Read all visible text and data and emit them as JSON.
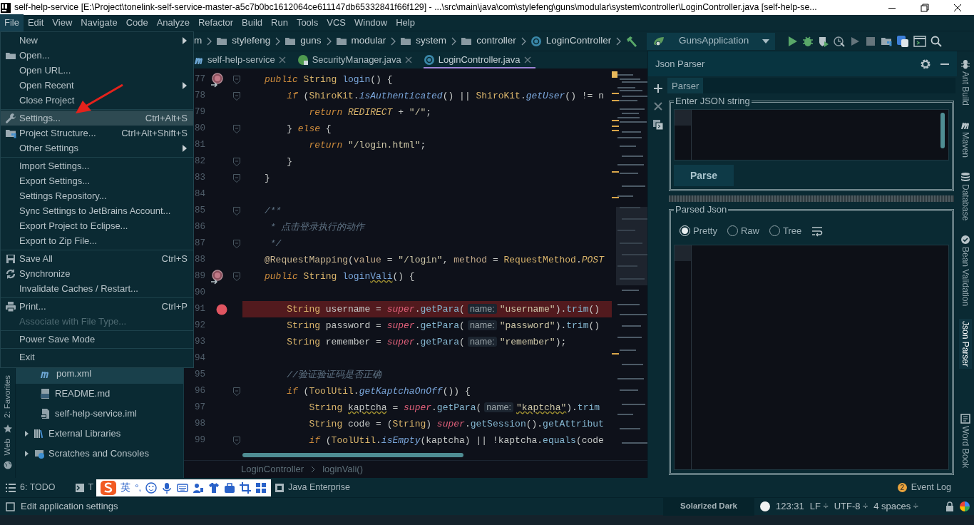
{
  "window": {
    "title": "self-help-service [E:\\Project\\tonelink-self-service-master-a5c7b0bc1612064ce611147db65332841f66f129] - ...\\src\\main\\java\\com\\stylefeng\\guns\\modular\\system\\controller\\LoginController.java [self-help-se..."
  },
  "menu_bar": [
    {
      "label": "File",
      "selected": true
    },
    {
      "label": "Edit",
      "selected": false
    },
    {
      "label": "View",
      "selected": false
    },
    {
      "label": "Navigate",
      "selected": false
    },
    {
      "label": "Code",
      "selected": false
    },
    {
      "label": "Analyze",
      "selected": false
    },
    {
      "label": "Refactor",
      "selected": false
    },
    {
      "label": "Build",
      "selected": false
    },
    {
      "label": "Run",
      "selected": false
    },
    {
      "label": "Tools",
      "selected": false
    },
    {
      "label": "VCS",
      "selected": false
    },
    {
      "label": "Window",
      "selected": false
    },
    {
      "label": "Help",
      "selected": false
    }
  ],
  "file_menu": [
    {
      "kind": "item",
      "label": "New",
      "submenu": true,
      "disabled": false,
      "selected": false
    },
    {
      "kind": "item",
      "label": "Open...",
      "submenu": false,
      "disabled": false,
      "selected": false
    },
    {
      "kind": "item",
      "label": "Open URL...",
      "submenu": false,
      "disabled": false,
      "selected": false
    },
    {
      "kind": "item",
      "label": "Open Recent",
      "submenu": true,
      "disabled": false,
      "selected": false
    },
    {
      "kind": "item",
      "label": "Close Project",
      "submenu": false,
      "disabled": false,
      "selected": false
    },
    {
      "kind": "separator"
    },
    {
      "kind": "item",
      "label": "Settings...",
      "shortcut": "Ctrl+Alt+S",
      "submenu": false,
      "disabled": false,
      "selected": true
    },
    {
      "kind": "item",
      "label": "Project Structure...",
      "shortcut": "Ctrl+Alt+Shift+S",
      "submenu": false,
      "disabled": false,
      "selected": false
    },
    {
      "kind": "item",
      "label": "Other Settings",
      "submenu": true,
      "disabled": false,
      "selected": false
    },
    {
      "kind": "separator"
    },
    {
      "kind": "item",
      "label": "Import Settings...",
      "submenu": false,
      "disabled": false,
      "selected": false
    },
    {
      "kind": "item",
      "label": "Export Settings...",
      "submenu": false,
      "disabled": false,
      "selected": false
    },
    {
      "kind": "item",
      "label": "Settings Repository...",
      "submenu": false,
      "disabled": false,
      "selected": false
    },
    {
      "kind": "item",
      "label": "Sync Settings to JetBrains Account...",
      "submenu": false,
      "disabled": false,
      "selected": false
    },
    {
      "kind": "item",
      "label": "Export Project to Eclipse...",
      "submenu": false,
      "disabled": false,
      "selected": false
    },
    {
      "kind": "item",
      "label": "Export to Zip File...",
      "submenu": false,
      "disabled": false,
      "selected": false
    },
    {
      "kind": "separator"
    },
    {
      "kind": "item",
      "label": "Save All",
      "shortcut": "Ctrl+S",
      "submenu": false,
      "disabled": false,
      "selected": false
    },
    {
      "kind": "item",
      "label": "Synchronize",
      "submenu": false,
      "disabled": false,
      "selected": false
    },
    {
      "kind": "item",
      "label": "Invalidate Caches / Restart...",
      "submenu": false,
      "disabled": false,
      "selected": false
    },
    {
      "kind": "separator"
    },
    {
      "kind": "item",
      "label": "Print...",
      "shortcut": "Ctrl+P",
      "submenu": false,
      "disabled": false,
      "selected": false
    },
    {
      "kind": "item",
      "label": "Associate with File Type...",
      "submenu": false,
      "disabled": true,
      "selected": false
    },
    {
      "kind": "separator"
    },
    {
      "kind": "item",
      "label": "Power Save Mode",
      "submenu": false,
      "disabled": false,
      "selected": false
    },
    {
      "kind": "separator"
    },
    {
      "kind": "item",
      "label": "Exit",
      "submenu": false,
      "disabled": false,
      "selected": false
    }
  ],
  "breadcrumbs": [
    "m",
    "stylefeng",
    "guns",
    "modular",
    "system",
    "controller",
    "LoginController"
  ],
  "run_config": "GunsApplication",
  "editor_tabs": [
    {
      "label": "self-help-service",
      "selected": false
    },
    {
      "label": "SecurityManager.java",
      "selected": false
    },
    {
      "label": "LoginController.java",
      "selected": true
    }
  ],
  "code_lines": [
    {
      "number": "77",
      "kind": "method",
      "fold": true,
      "tokens": [
        {
          "text": "    public",
          "kind": "keyword"
        },
        {
          "text": " String ",
          "kind": "type"
        },
        {
          "text": "login",
          "kind": "method"
        },
        {
          "text": "() {",
          "kind": "plain"
        }
      ]
    },
    {
      "number": "78",
      "fold": true,
      "tokens": [
        {
          "text": "        if",
          "kind": "keyword"
        },
        {
          "text": " (",
          "kind": "plain"
        },
        {
          "text": "ShiroKit",
          "kind": "type"
        },
        {
          "text": ".",
          "kind": "plain"
        },
        {
          "text": "isAuthenticated",
          "kind": "static"
        },
        {
          "text": "() || ",
          "kind": "plain"
        },
        {
          "text": "ShiroKit",
          "kind": "type"
        },
        {
          "text": ".",
          "kind": "plain"
        },
        {
          "text": "getUser",
          "kind": "static"
        },
        {
          "text": "() != n",
          "kind": "plain"
        }
      ]
    },
    {
      "number": "79",
      "fold": false,
      "tokens": [
        {
          "text": "            return ",
          "kind": "keyword"
        },
        {
          "text": "REDIRECT",
          "kind": "constant"
        },
        {
          "text": " + ",
          "kind": "plain"
        },
        {
          "text": "\"/\"",
          "kind": "string"
        },
        {
          "text": ";",
          "kind": "plain"
        }
      ]
    },
    {
      "number": "80",
      "fold": true,
      "tokens": [
        {
          "text": "        } ",
          "kind": "plain"
        },
        {
          "text": "else",
          "kind": "keyword"
        },
        {
          "text": " {",
          "kind": "plain"
        }
      ]
    },
    {
      "number": "81",
      "fold": false,
      "tokens": [
        {
          "text": "            return ",
          "kind": "keyword"
        },
        {
          "text": "\"/login.html\"",
          "kind": "string"
        },
        {
          "text": ";",
          "kind": "plain"
        }
      ]
    },
    {
      "number": "82",
      "fold": true,
      "tokens": [
        {
          "text": "        }",
          "kind": "plain"
        }
      ]
    },
    {
      "number": "83",
      "fold": true,
      "tokens": [
        {
          "text": "    }",
          "kind": "plain"
        }
      ]
    },
    {
      "number": "84",
      "fold": false
    },
    {
      "number": "85",
      "fold": true,
      "tokens": [
        {
          "text": "    /**",
          "kind": "comment"
        }
      ]
    },
    {
      "number": "86",
      "fold": false,
      "tokens": [
        {
          "text": "     * 点击登录执行的动作",
          "kind": "comment"
        }
      ]
    },
    {
      "number": "87",
      "fold": true,
      "tokens": [
        {
          "text": "     */",
          "kind": "comment"
        }
      ]
    },
    {
      "number": "88",
      "fold": false,
      "tokens": [
        {
          "text": "    @RequestMapping",
          "kind": "annotation"
        },
        {
          "text": "(",
          "kind": "plain"
        },
        {
          "text": "value",
          "kind": "param"
        },
        {
          "text": " = ",
          "kind": "plain"
        },
        {
          "text": "\"/login\"",
          "kind": "string"
        },
        {
          "text": ", ",
          "kind": "plain"
        },
        {
          "text": "method",
          "kind": "param"
        },
        {
          "text": " = ",
          "kind": "plain"
        },
        {
          "text": "RequestMethod",
          "kind": "type"
        },
        {
          "text": ".",
          "kind": "plain"
        },
        {
          "text": "POST",
          "kind": "constant"
        }
      ]
    },
    {
      "number": "89",
      "kind": "method",
      "fold": true,
      "tokens": [
        {
          "text": "    public",
          "kind": "keyword"
        },
        {
          "text": " String ",
          "kind": "type"
        },
        {
          "text": "login",
          "kind": "method"
        },
        {
          "text": "Vali",
          "kind": "method",
          "typo": true
        },
        {
          "text": "() {",
          "kind": "plain"
        }
      ]
    },
    {
      "number": "90",
      "fold": false
    },
    {
      "number": "91",
      "kind": "breakpoint",
      "fold": false,
      "tokens": [
        {
          "text": "        String",
          "kind": "type"
        },
        {
          "text": " username = ",
          "kind": "plain"
        },
        {
          "text": "super",
          "kind": "super"
        },
        {
          "text": ".",
          "kind": "plain"
        },
        {
          "text": "getPara",
          "kind": "call"
        },
        {
          "text": "(",
          "kind": "plain"
        },
        {
          "text": "name:",
          "kind": "hint"
        },
        {
          "text": "\"username\"",
          "kind": "string"
        },
        {
          "text": ").",
          "kind": "plain"
        },
        {
          "text": "trim",
          "kind": "call"
        },
        {
          "text": "()",
          "kind": "plain"
        }
      ]
    },
    {
      "number": "92",
      "fold": false,
      "tokens": [
        {
          "text": "        String",
          "kind": "type"
        },
        {
          "text": " password = ",
          "kind": "plain"
        },
        {
          "text": "super",
          "kind": "super"
        },
        {
          "text": ".",
          "kind": "plain"
        },
        {
          "text": "getPara",
          "kind": "call"
        },
        {
          "text": "(",
          "kind": "plain"
        },
        {
          "text": "name:",
          "kind": "hint"
        },
        {
          "text": "\"password\"",
          "kind": "string"
        },
        {
          "text": ").",
          "kind": "plain"
        },
        {
          "text": "trim",
          "kind": "call"
        },
        {
          "text": "()",
          "kind": "plain"
        }
      ]
    },
    {
      "number": "93",
      "fold": false,
      "tokens": [
        {
          "text": "        String",
          "kind": "type"
        },
        {
          "text": " remember = ",
          "kind": "plain"
        },
        {
          "text": "super",
          "kind": "super"
        },
        {
          "text": ".",
          "kind": "plain"
        },
        {
          "text": "getPara",
          "kind": "call"
        },
        {
          "text": "(",
          "kind": "plain"
        },
        {
          "text": "name:",
          "kind": "hint"
        },
        {
          "text": "\"remember\"",
          "kind": "string"
        },
        {
          "text": ");",
          "kind": "plain"
        }
      ]
    },
    {
      "number": "94",
      "fold": false
    },
    {
      "number": "95",
      "fold": false,
      "tokens": [
        {
          "text": "        //验证验证码是否正确",
          "kind": "comment"
        }
      ]
    },
    {
      "number": "96",
      "fold": true,
      "tokens": [
        {
          "text": "        if",
          "kind": "keyword"
        },
        {
          "text": " (",
          "kind": "plain"
        },
        {
          "text": "ToolUtil",
          "kind": "type"
        },
        {
          "text": ".",
          "kind": "plain"
        },
        {
          "text": "getKaptchaOnOff",
          "kind": "static"
        },
        {
          "text": "()) {",
          "kind": "plain"
        }
      ]
    },
    {
      "number": "97",
      "fold": false,
      "tokens": [
        {
          "text": "            String ",
          "kind": "type"
        },
        {
          "text": "kaptcha",
          "kind": "plain",
          "typo": true
        },
        {
          "text": " = ",
          "kind": "plain"
        },
        {
          "text": "super",
          "kind": "super"
        },
        {
          "text": ".",
          "kind": "plain"
        },
        {
          "text": "getPara",
          "kind": "call"
        },
        {
          "text": "(",
          "kind": "plain"
        },
        {
          "text": "name:",
          "kind": "hint"
        },
        {
          "text": "\"kaptcha\"",
          "kind": "string",
          "typo": true
        },
        {
          "text": ").",
          "kind": "plain"
        },
        {
          "text": "trim",
          "kind": "call"
        }
      ]
    },
    {
      "number": "98",
      "fold": false,
      "tokens": [
        {
          "text": "            String",
          "kind": "type"
        },
        {
          "text": " code = (",
          "kind": "plain"
        },
        {
          "text": "String",
          "kind": "type"
        },
        {
          "text": ") ",
          "kind": "plain"
        },
        {
          "text": "super",
          "kind": "super"
        },
        {
          "text": ".",
          "kind": "plain"
        },
        {
          "text": "getSession",
          "kind": "call"
        },
        {
          "text": "().",
          "kind": "plain"
        },
        {
          "text": "getAttribut",
          "kind": "call"
        }
      ]
    },
    {
      "number": "99",
      "fold": true,
      "tokens": [
        {
          "text": "            if",
          "kind": "keyword"
        },
        {
          "text": " (",
          "kind": "plain"
        },
        {
          "text": "ToolUtil",
          "kind": "type"
        },
        {
          "text": ".",
          "kind": "plain"
        },
        {
          "text": "isEmpty",
          "kind": "static"
        },
        {
          "text": "(kaptcha) || !kaptcha.",
          "kind": "plain"
        },
        {
          "text": "equals",
          "kind": "call"
        },
        {
          "text": "(code",
          "kind": "plain"
        }
      ]
    }
  ],
  "editor_breadcrumbs": [
    "LoginController",
    "loginVali()"
  ],
  "project_tree": [
    {
      "label": "pom.xml",
      "kind": "file",
      "selected": true
    },
    {
      "label": "README.md",
      "kind": "file",
      "selected": false
    },
    {
      "label": "self-help-service.iml",
      "kind": "file",
      "selected": false
    },
    {
      "label": "External Libraries",
      "kind": "folder",
      "expanded": false,
      "selected": false
    },
    {
      "label": "Scratches and Consoles",
      "kind": "folder",
      "expanded": false,
      "selected": false
    }
  ],
  "left_stripe": [
    "2: Favorites",
    "Web"
  ],
  "json_parser": {
    "title": "Json Parser",
    "tabs": [
      {
        "label": "Parser",
        "selected": true
      }
    ],
    "input_group": "Enter JSON string",
    "parse_button": "Parse",
    "output_group": "Parsed Json",
    "view_modes": [
      {
        "label": "Pretty",
        "selected": true
      },
      {
        "label": "Raw",
        "selected": false
      },
      {
        "label": "Tree",
        "selected": false
      }
    ]
  },
  "right_stripe": [
    {
      "label": "Ant Build",
      "selected": false
    },
    {
      "label": "Maven",
      "selected": false
    },
    {
      "label": "Database",
      "selected": false
    },
    {
      "label": "Bean Validation",
      "selected": false
    },
    {
      "label": "Json Parser",
      "selected": true
    },
    {
      "label": "Word Book",
      "selected": false
    }
  ],
  "bottom_tabs": [
    "6: TODO",
    "T",
    "Java Enterprise"
  ],
  "ime_bar": {
    "language": "英",
    "punctuation": "°,"
  },
  "event_log": {
    "label": "Event Log",
    "badge": "2"
  },
  "status_bar": {
    "message": "Edit application settings",
    "theme": "Solarized Dark",
    "position": "123:31",
    "line_separator": "LF ÷",
    "encoding": "UTF-8 ÷",
    "indent": "4 spaces ÷"
  }
}
